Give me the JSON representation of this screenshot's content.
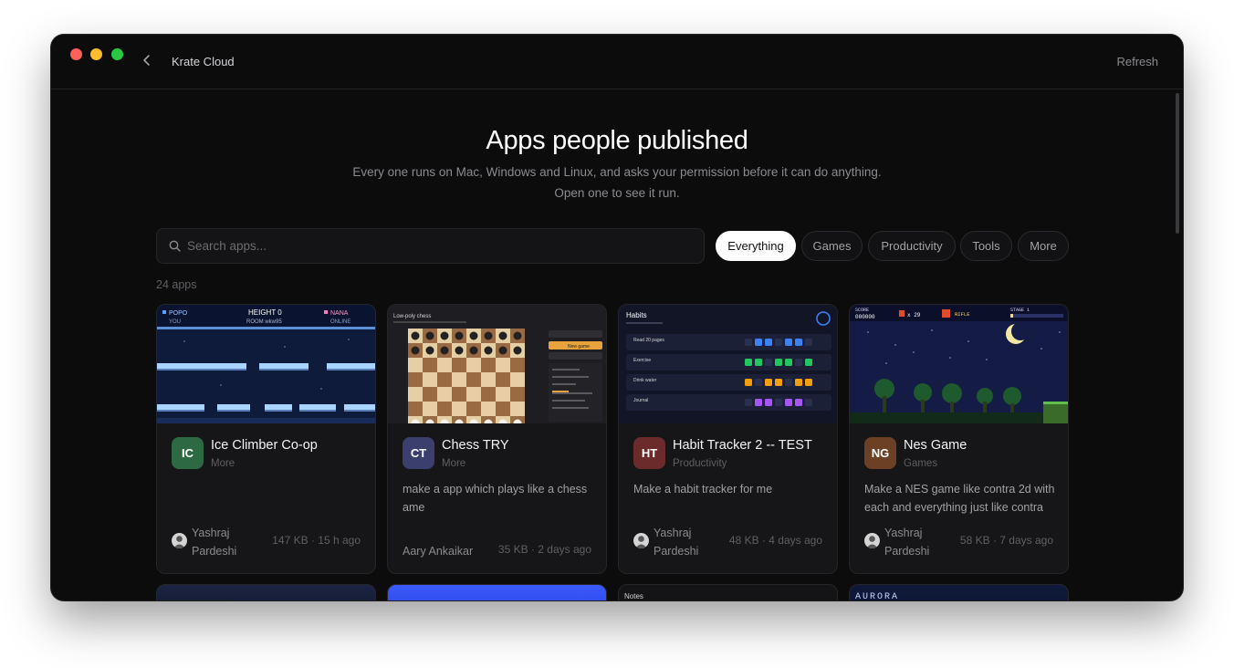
{
  "window": {
    "title": "Krate Cloud",
    "refresh_label": "Refresh"
  },
  "hero": {
    "title": "Apps people published",
    "subtitle_line1": "Every one runs on Mac, Windows and Linux, and asks your permission before it can do anything.",
    "subtitle_line2": "Open one to see it run."
  },
  "search": {
    "placeholder": "Search apps..."
  },
  "filters": [
    "Everything",
    "Games",
    "Productivity",
    "Tools",
    "More"
  ],
  "active_filter": "Everything",
  "app_count": "24 apps",
  "apps": [
    {
      "initials": "IC",
      "name": "Ice Climber Co-op",
      "category": "More",
      "description": "",
      "author": "Yashraj Pardeshi",
      "meta": "147 KB · 15 h ago",
      "tile_color": "#2d6a43",
      "preview": {
        "left_player": "POPO",
        "left_sub": "YOU",
        "center_title": "HEIGHT 0",
        "center_sub": "ROOM wkw95",
        "right_player": "NANA",
        "right_sub": "ONLINE"
      }
    },
    {
      "initials": "CT",
      "name": "Chess TRY",
      "category": "More",
      "description": "make a app which plays like a chess ame",
      "author": "Aary Ankaikar",
      "meta": "35 KB · 2 days ago",
      "tile_color": "#3a3f6e",
      "preview": {
        "title": "Low-poly chess",
        "button": "New game"
      }
    },
    {
      "initials": "HT",
      "name": "Habit Tracker 2 -- TEST",
      "category": "Productivity",
      "description": "Make a habit tracker for me",
      "author": "Yashraj Pardeshi",
      "meta": "48 KB · 4 days ago",
      "tile_color": "#6b2b2b",
      "preview": {
        "title": "Habits",
        "habits": [
          "Read 20 pages",
          "Exercise",
          "Drink water",
          "Journal"
        ]
      }
    },
    {
      "initials": "NG",
      "name": "Nes Game",
      "category": "Games",
      "description": "Make a NES game like contra 2d with each and everything just like contra",
      "author": "Yashraj Pardeshi",
      "meta": "58 KB · 7 days ago",
      "tile_color": "#6b4024",
      "preview": {
        "score_label": "SCORE",
        "score": "000000",
        "lives": "x 29",
        "weapon": "RIFLE",
        "stage": "STAGE 1"
      }
    }
  ],
  "row2_previews": [
    {
      "label": ""
    },
    {
      "label": ""
    },
    {
      "label": "Notes"
    },
    {
      "label": "AURORA"
    }
  ],
  "colors": {
    "background": "#0c0c0d",
    "card": "#161618",
    "accent_active_chip": "#ffffff"
  }
}
